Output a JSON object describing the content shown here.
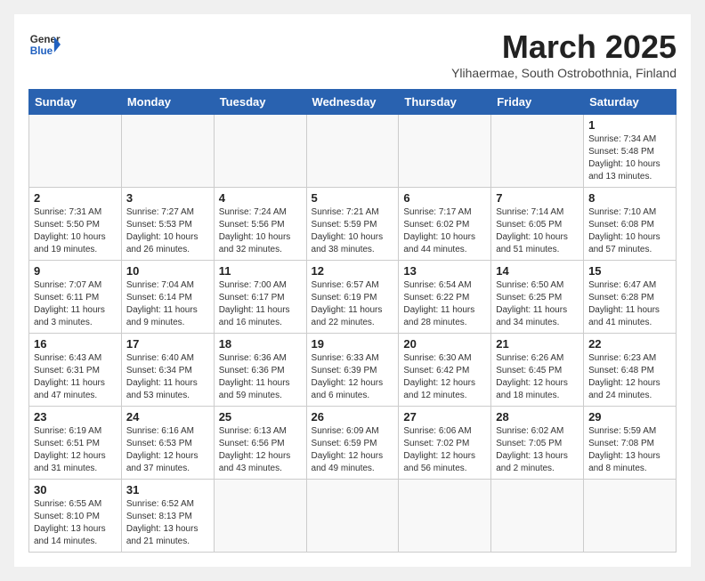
{
  "header": {
    "logo_general": "General",
    "logo_blue": "Blue",
    "month": "March 2025",
    "location": "Ylihaermae, South Ostrobothnia, Finland"
  },
  "weekdays": [
    "Sunday",
    "Monday",
    "Tuesday",
    "Wednesday",
    "Thursday",
    "Friday",
    "Saturday"
  ],
  "weeks": [
    [
      {
        "day": "",
        "info": ""
      },
      {
        "day": "",
        "info": ""
      },
      {
        "day": "",
        "info": ""
      },
      {
        "day": "",
        "info": ""
      },
      {
        "day": "",
        "info": ""
      },
      {
        "day": "",
        "info": ""
      },
      {
        "day": "1",
        "info": "Sunrise: 7:34 AM\nSunset: 5:48 PM\nDaylight: 10 hours and 13 minutes."
      }
    ],
    [
      {
        "day": "2",
        "info": "Sunrise: 7:31 AM\nSunset: 5:50 PM\nDaylight: 10 hours and 19 minutes."
      },
      {
        "day": "3",
        "info": "Sunrise: 7:27 AM\nSunset: 5:53 PM\nDaylight: 10 hours and 26 minutes."
      },
      {
        "day": "4",
        "info": "Sunrise: 7:24 AM\nSunset: 5:56 PM\nDaylight: 10 hours and 32 minutes."
      },
      {
        "day": "5",
        "info": "Sunrise: 7:21 AM\nSunset: 5:59 PM\nDaylight: 10 hours and 38 minutes."
      },
      {
        "day": "6",
        "info": "Sunrise: 7:17 AM\nSunset: 6:02 PM\nDaylight: 10 hours and 44 minutes."
      },
      {
        "day": "7",
        "info": "Sunrise: 7:14 AM\nSunset: 6:05 PM\nDaylight: 10 hours and 51 minutes."
      },
      {
        "day": "8",
        "info": "Sunrise: 7:10 AM\nSunset: 6:08 PM\nDaylight: 10 hours and 57 minutes."
      }
    ],
    [
      {
        "day": "9",
        "info": "Sunrise: 7:07 AM\nSunset: 6:11 PM\nDaylight: 11 hours and 3 minutes."
      },
      {
        "day": "10",
        "info": "Sunrise: 7:04 AM\nSunset: 6:14 PM\nDaylight: 11 hours and 9 minutes."
      },
      {
        "day": "11",
        "info": "Sunrise: 7:00 AM\nSunset: 6:17 PM\nDaylight: 11 hours and 16 minutes."
      },
      {
        "day": "12",
        "info": "Sunrise: 6:57 AM\nSunset: 6:19 PM\nDaylight: 11 hours and 22 minutes."
      },
      {
        "day": "13",
        "info": "Sunrise: 6:54 AM\nSunset: 6:22 PM\nDaylight: 11 hours and 28 minutes."
      },
      {
        "day": "14",
        "info": "Sunrise: 6:50 AM\nSunset: 6:25 PM\nDaylight: 11 hours and 34 minutes."
      },
      {
        "day": "15",
        "info": "Sunrise: 6:47 AM\nSunset: 6:28 PM\nDaylight: 11 hours and 41 minutes."
      }
    ],
    [
      {
        "day": "16",
        "info": "Sunrise: 6:43 AM\nSunset: 6:31 PM\nDaylight: 11 hours and 47 minutes."
      },
      {
        "day": "17",
        "info": "Sunrise: 6:40 AM\nSunset: 6:34 PM\nDaylight: 11 hours and 53 minutes."
      },
      {
        "day": "18",
        "info": "Sunrise: 6:36 AM\nSunset: 6:36 PM\nDaylight: 11 hours and 59 minutes."
      },
      {
        "day": "19",
        "info": "Sunrise: 6:33 AM\nSunset: 6:39 PM\nDaylight: 12 hours and 6 minutes."
      },
      {
        "day": "20",
        "info": "Sunrise: 6:30 AM\nSunset: 6:42 PM\nDaylight: 12 hours and 12 minutes."
      },
      {
        "day": "21",
        "info": "Sunrise: 6:26 AM\nSunset: 6:45 PM\nDaylight: 12 hours and 18 minutes."
      },
      {
        "day": "22",
        "info": "Sunrise: 6:23 AM\nSunset: 6:48 PM\nDaylight: 12 hours and 24 minutes."
      }
    ],
    [
      {
        "day": "23",
        "info": "Sunrise: 6:19 AM\nSunset: 6:51 PM\nDaylight: 12 hours and 31 minutes."
      },
      {
        "day": "24",
        "info": "Sunrise: 6:16 AM\nSunset: 6:53 PM\nDaylight: 12 hours and 37 minutes."
      },
      {
        "day": "25",
        "info": "Sunrise: 6:13 AM\nSunset: 6:56 PM\nDaylight: 12 hours and 43 minutes."
      },
      {
        "day": "26",
        "info": "Sunrise: 6:09 AM\nSunset: 6:59 PM\nDaylight: 12 hours and 49 minutes."
      },
      {
        "day": "27",
        "info": "Sunrise: 6:06 AM\nSunset: 7:02 PM\nDaylight: 12 hours and 56 minutes."
      },
      {
        "day": "28",
        "info": "Sunrise: 6:02 AM\nSunset: 7:05 PM\nDaylight: 13 hours and 2 minutes."
      },
      {
        "day": "29",
        "info": "Sunrise: 5:59 AM\nSunset: 7:08 PM\nDaylight: 13 hours and 8 minutes."
      }
    ],
    [
      {
        "day": "30",
        "info": "Sunrise: 6:55 AM\nSunset: 8:10 PM\nDaylight: 13 hours and 14 minutes."
      },
      {
        "day": "31",
        "info": "Sunrise: 6:52 AM\nSunset: 8:13 PM\nDaylight: 13 hours and 21 minutes."
      },
      {
        "day": "",
        "info": ""
      },
      {
        "day": "",
        "info": ""
      },
      {
        "day": "",
        "info": ""
      },
      {
        "day": "",
        "info": ""
      },
      {
        "day": "",
        "info": ""
      }
    ]
  ]
}
